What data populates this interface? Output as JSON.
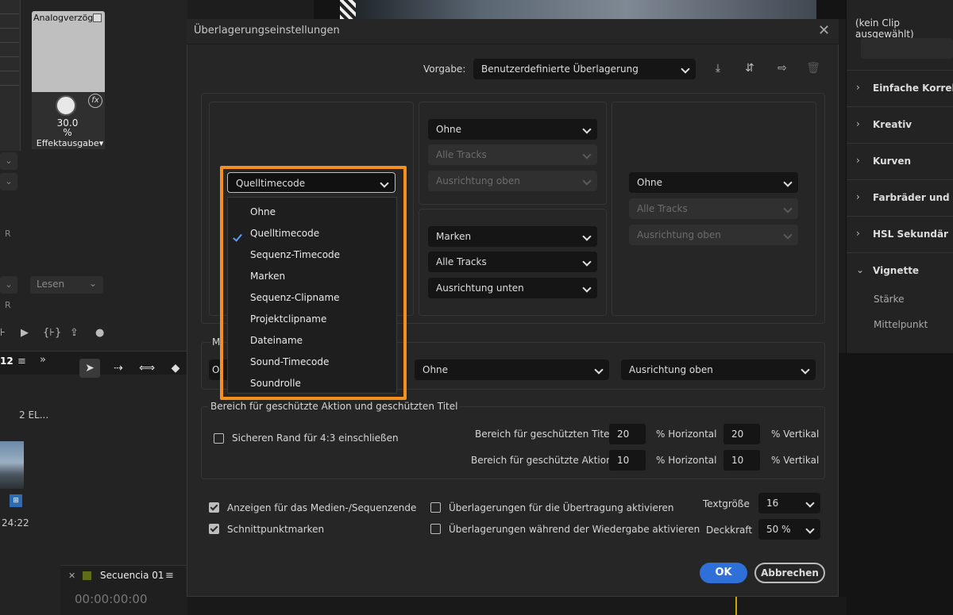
{
  "background": {
    "knob_label": "Analogverzög",
    "knob_value": "30.0",
    "knob_unit": "%",
    "knob_output": "Effektausgabe",
    "lesen": "Lesen",
    "r_label": "R",
    "tab_number": "12",
    "elements": "2 EL...",
    "timecode_small": "24:22",
    "sequence_name": "Secuencia 01",
    "sequence_timecode": "00:00:00:00",
    "right_panel_top": "(kein Clip ausgewählt)",
    "right_panel_items": [
      "Einfache Korrektur",
      "Kreativ",
      "Kurven",
      "Farbräder und Farb",
      "HSL Sekundär",
      "Vignette"
    ],
    "right_panel_sub": [
      "Stärke",
      "Mittelpunkt"
    ]
  },
  "dialog": {
    "title": "Überlagerungseinstellungen",
    "preset_label": "Vorgabe:",
    "preset_value": "Benutzerdefinierte Überlagerung",
    "top_left_select": "Quelltimecode",
    "top_mid_upper": {
      "main": "Ohne",
      "tracks": "Alle Tracks",
      "align": "Ausrichtung oben"
    },
    "top_mid_lower": {
      "main": "Marken",
      "tracks": "Alle Tracks",
      "align": "Ausrichtung unten"
    },
    "top_right": {
      "main": "Ohne",
      "tracks": "Alle Tracks",
      "align": "Ausrichtung oben"
    },
    "middle_group_label": "M",
    "middle_left_value": "O",
    "middle_mid_value": "Ohne",
    "middle_right_value": "Ausrichtung oben",
    "dropdown_options": [
      "Ohne",
      "Quelltimecode",
      "Sequenz-Timecode",
      "Marken",
      "Sequenz-Clipname",
      "Projektclipname",
      "Dateiname",
      "Sound-Timecode",
      "Soundrolle"
    ],
    "dropdown_selected": "Quelltimecode",
    "safe_area": {
      "legend": "Bereich für geschützte Aktion und geschützten Titel",
      "checkbox_label": "Sicheren Rand für 4:3 einschließen",
      "title_label": "Bereich für geschützten Titel",
      "action_label": "Bereich für geschützte Aktion",
      "title_h": "20",
      "title_v": "20",
      "action_h": "10",
      "action_v": "10",
      "h_suffix": "% Horizontal",
      "v_suffix": "% Vertikal"
    },
    "options": {
      "show_end": "Anzeigen für das Medien-/Sequenzende",
      "cut_markers": "Schnittpunktmarken",
      "broadcast": "Überlagerungen für die Übertragung aktivieren",
      "playback": "Überlagerungen während der Wiedergabe aktivieren",
      "text_size_label": "Textgröße",
      "text_size_value": "16",
      "opacity_label": "Deckkraft",
      "opacity_value": "50 %"
    },
    "ok_label": "OK",
    "cancel_label": "Abbrechen"
  }
}
